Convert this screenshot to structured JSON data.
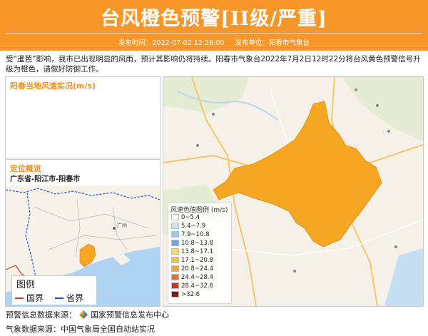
{
  "header": {
    "title": "台风橙色预警[II级/严重]",
    "publish_time": "发布时间：2022-07-02 12:26:00",
    "publish_unit": "发布单位：阳春市气象台",
    "color": "#f8962a"
  },
  "description": "受“暹芭”影响，我市已出现明显的风雨，预计其影响仍将持续。阳春市气象台2022年7月2日12时22分将台风黄色预警信号升级为橙色，请做好防御工作。",
  "wind_panel": {
    "title": "阳春当地风速实况(m/s)"
  },
  "location_panel": {
    "title": "定位概览",
    "path": "广东省-阳江市-阳春市",
    "map_label": "广州",
    "legend": {
      "title": "图例",
      "items": [
        {
          "label": "国界",
          "color": "#c0392b"
        },
        {
          "label": "省界",
          "color": "#1f4fd6"
        }
      ]
    }
  },
  "wind_legend": {
    "title": "风速色值图例 (m/s)",
    "items": [
      {
        "label": "0~5.4",
        "color": "#ffffff"
      },
      {
        "label": "5.4~7.9",
        "color": "#cfe3f7"
      },
      {
        "label": "7.9~10.8",
        "color": "#9cc8f0"
      },
      {
        "label": "10.8~13.8",
        "color": "#6aa6e3"
      },
      {
        "label": "13.8~17.1",
        "color": "#f5e14a"
      },
      {
        "label": "17.1~20.8",
        "color": "#f8c23a"
      },
      {
        "label": "20.8~24.4",
        "color": "#f5a623"
      },
      {
        "label": "24.4~28.4",
        "color": "#f07022"
      },
      {
        "label": "28.4~32.6",
        "color": "#d9301c"
      },
      {
        "label": ">32.6",
        "color": "#8e0f0f"
      }
    ]
  },
  "footer": {
    "warning_source_label": "预警信息数据来源：",
    "warning_source": "国家预警信息发布中心",
    "weather_source_label": "气象数据来源：",
    "weather_source": "中国气象局全国自动站实况"
  }
}
